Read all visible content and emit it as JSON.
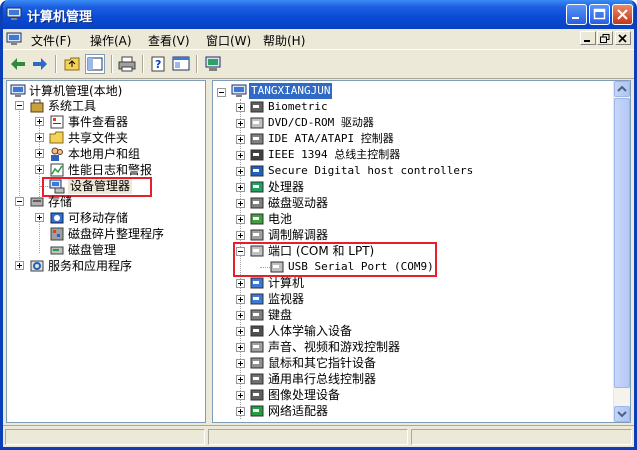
{
  "window": {
    "title": "计算机管理"
  },
  "menu": {
    "file": "文件(F)",
    "action": "操作(A)",
    "view": "查看(V)",
    "window": "窗口(W)",
    "help": "帮助(H)"
  },
  "left_tree": {
    "root": "计算机管理(本地)",
    "system_tools": "系统工具",
    "event_viewer": "事件查看器",
    "shared_folders": "共享文件夹",
    "local_users": "本地用户和组",
    "perf_logs": "性能日志和警报",
    "device_manager": "设备管理器",
    "storage": "存储",
    "removable_storage": "可移动存储",
    "defrag": "磁盘碎片整理程序",
    "disk_mgmt": "磁盘管理",
    "services": "服务和应用程序"
  },
  "right_tree": {
    "root": "TANGXIANGJUN",
    "items": [
      "Biometric",
      "DVD/CD-ROM 驱动器",
      "IDE ATA/ATAPI 控制器",
      "IEEE 1394 总线主控制器",
      "Secure Digital host controllers",
      "处理器",
      "磁盘驱动器",
      "电池",
      "调制解调器",
      "端口 (COM 和 LPT)",
      "USB Serial Port (COM9)",
      "计算机",
      "监视器",
      "键盘",
      "人体学输入设备",
      "声音、视频和游戏控制器",
      "鼠标和其它指针设备",
      "通用串行总线控制器",
      "图像处理设备",
      "网络适配器"
    ]
  },
  "colors": {
    "highlight": "#E5202A",
    "selection": "#316AC5",
    "titlebar": "#0A4AD6"
  }
}
